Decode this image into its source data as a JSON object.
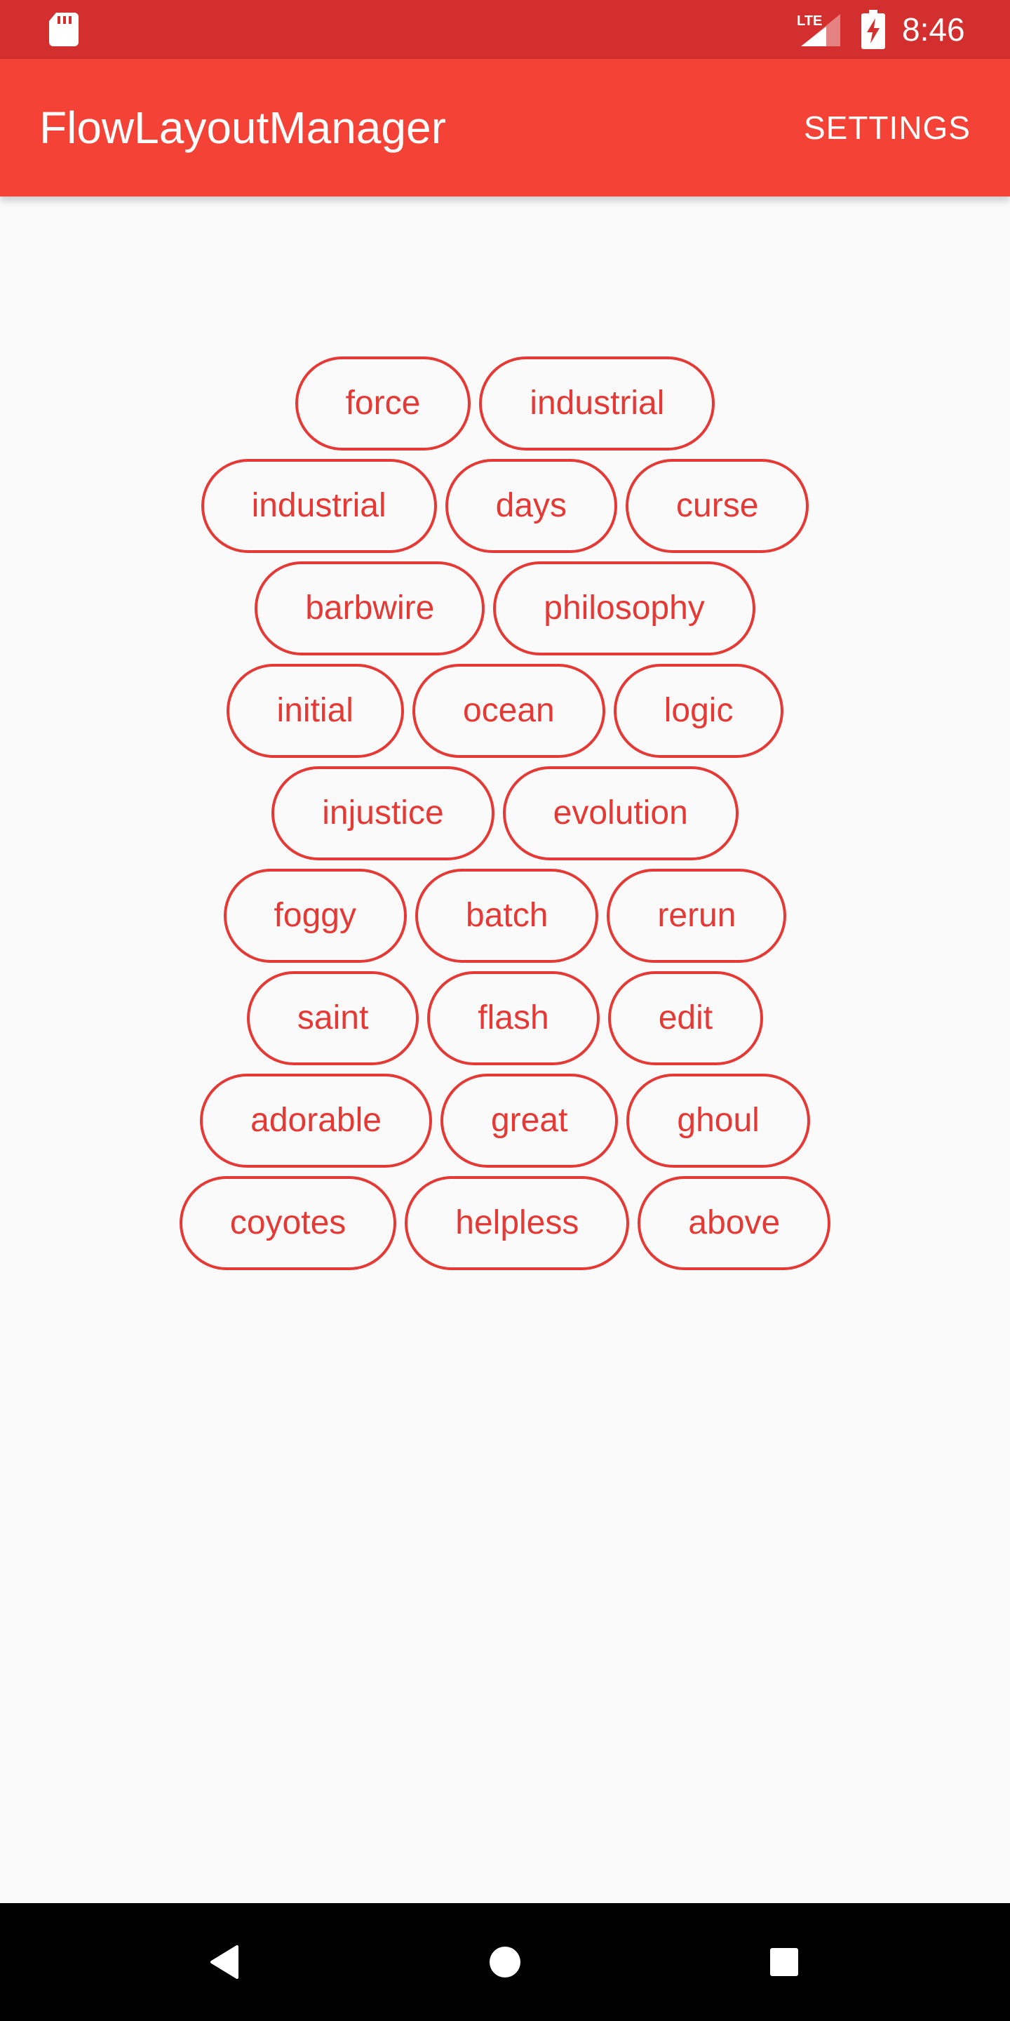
{
  "status_bar": {
    "time": "8:46",
    "network_label": "LTE",
    "icons": [
      "sd-card-icon",
      "lte-signal-icon",
      "battery-charging-icon"
    ]
  },
  "app_bar": {
    "title": "FlowLayoutManager",
    "settings_label": "SETTINGS",
    "color": "#f44336"
  },
  "colors": {
    "status_bar": "#d32f2f",
    "chip_accent": "#e53935",
    "background": "#fafafa"
  },
  "chips": [
    "force",
    "industrial",
    "industrial",
    "days",
    "curse",
    "barbwire",
    "philosophy",
    "initial",
    "ocean",
    "logic",
    "injustice",
    "evolution",
    "foggy",
    "batch",
    "rerun",
    "saint",
    "flash",
    "edit",
    "adorable",
    "great",
    "ghoul",
    "coyotes",
    "helpless",
    "above"
  ],
  "nav_bar": {
    "icons": [
      "back-icon",
      "home-icon",
      "recents-icon"
    ]
  }
}
